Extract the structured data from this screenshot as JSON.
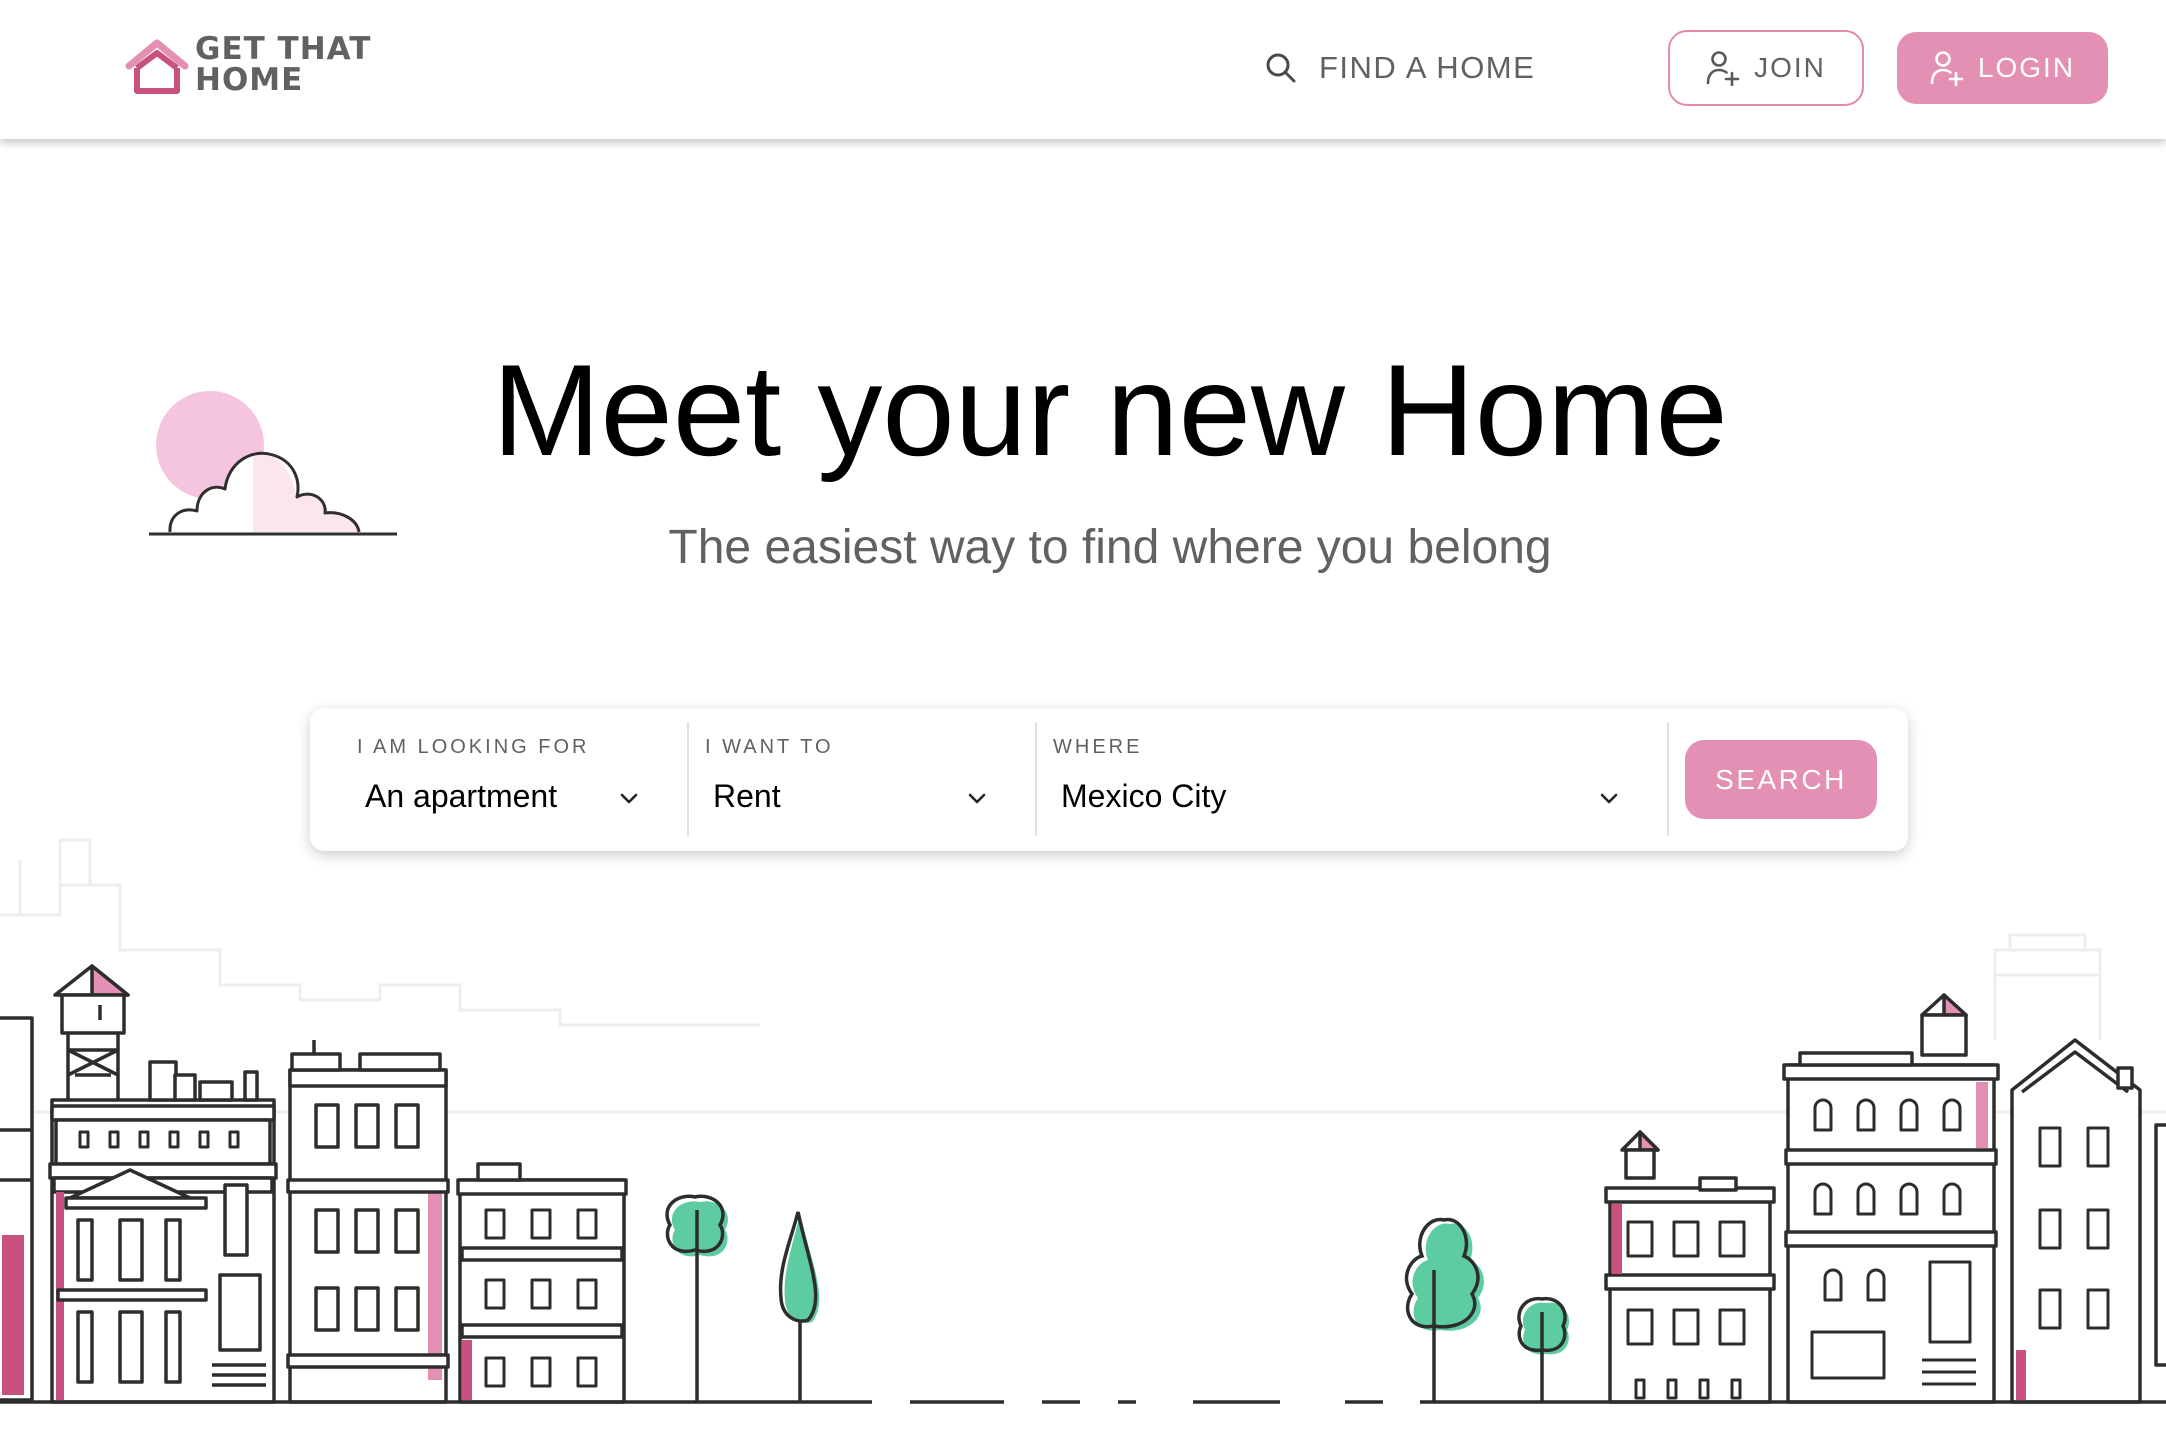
{
  "header": {
    "logo": {
      "line1": "GET THAT",
      "line2": "HOME"
    },
    "nav": {
      "find_home_label": "FIND A HOME"
    },
    "join_label": "JOIN",
    "login_label": "LOGIN"
  },
  "hero": {
    "title": "Meet your new Home",
    "subtitle": "The easiest way to find where you belong"
  },
  "search": {
    "property_type": {
      "label": "I AM LOOKING FOR",
      "value": "An apartment"
    },
    "operation": {
      "label": "I WANT TO",
      "value": "Rent"
    },
    "location": {
      "label": "WHERE",
      "value": "Mexico City"
    },
    "button_label": "SEARCH"
  },
  "icons": {
    "logo": "house-outline-logo-icon",
    "find": "search-icon",
    "join": "user-plus-icon",
    "login": "user-plus-icon",
    "dropdown": "chevron-down-icon"
  },
  "colors": {
    "brand_pink": "#e48fb4",
    "logo_pink": "#c9517f",
    "text_gray": "#616161",
    "tree_green": "#5ecca1",
    "sun_pink": "#f5c4df"
  }
}
